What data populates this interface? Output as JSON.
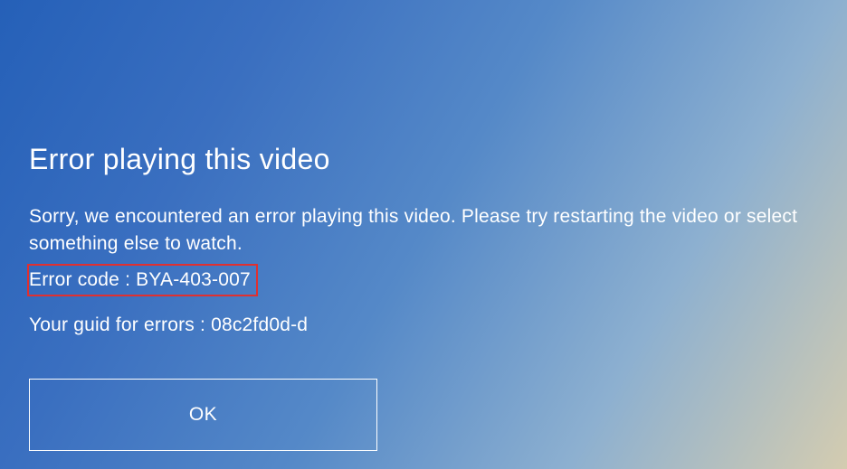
{
  "dialog": {
    "title": "Error playing this video",
    "message": "Sorry, we encountered an error playing this video. Please try restarting the video or select something else to watch.",
    "error_code_label": "Error code : BYA-403-007",
    "guid_label": "Your guid for errors : 08c2fd0d-d",
    "ok_button": "OK"
  },
  "colors": {
    "highlight_border": "#e03030"
  }
}
